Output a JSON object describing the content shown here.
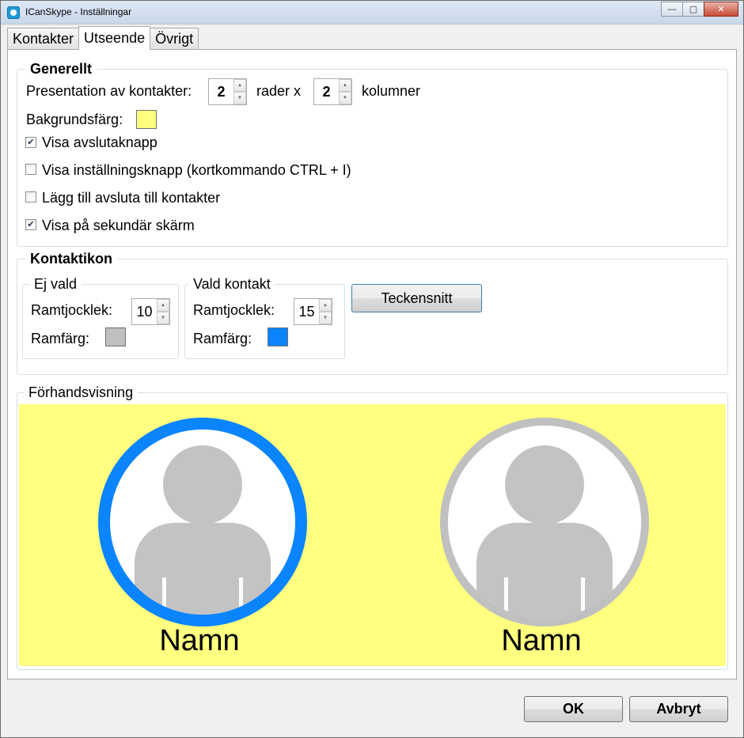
{
  "window": {
    "title": "ICanSkype - Inställningar",
    "controls": {
      "minimize": "—",
      "maximize": "▢",
      "close": "✕"
    }
  },
  "tabs": [
    {
      "label": "Kontakter",
      "active": false
    },
    {
      "label": "Utseende",
      "active": true
    },
    {
      "label": "Övrigt",
      "active": false
    }
  ],
  "general": {
    "title": "Generellt",
    "presentation_label": "Presentation av kontakter:",
    "rows_value": "2",
    "rows_suffix": "rader x",
    "cols_value": "2",
    "cols_suffix": "kolumner",
    "bg_label": "Bakgrundsfärg:",
    "bg_color": "#ffff80",
    "checkboxes": [
      {
        "label": "Visa avslutaknapp",
        "checked": true
      },
      {
        "label": "Visa inställningsknapp (kortkommando CTRL + I)",
        "checked": false
      },
      {
        "label": "Lägg till avsluta till kontakter",
        "checked": false
      },
      {
        "label": "Visa på sekundär skärm",
        "checked": true
      }
    ]
  },
  "contact_icon": {
    "title": "Kontaktikon",
    "not_selected": {
      "title": "Ej vald",
      "thickness_label": "Ramtjocklek:",
      "thickness_value": "10",
      "color_label": "Ramfärg:",
      "color": "#c0c0c0"
    },
    "selected": {
      "title": "Vald kontakt",
      "thickness_label": "Ramtjocklek:",
      "thickness_value": "15",
      "color_label": "Ramfärg:",
      "color": "#0a84ff"
    },
    "font_button": "Teckensnitt"
  },
  "preview": {
    "title": "Förhandsvisning",
    "contacts": [
      {
        "name": "Namn",
        "ring_color": "#0a84ff"
      },
      {
        "name": "Namn",
        "ring_color": "#c0c0c0"
      }
    ]
  },
  "footer": {
    "ok": "OK",
    "cancel": "Avbryt"
  }
}
